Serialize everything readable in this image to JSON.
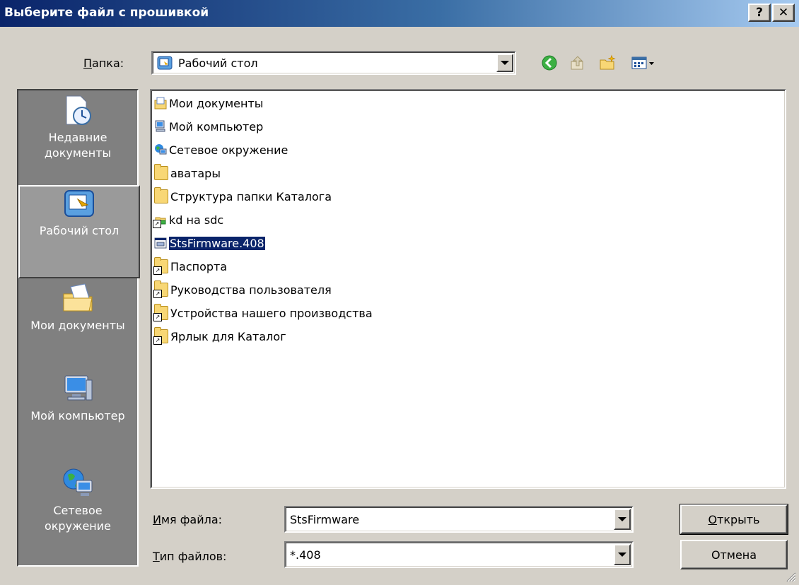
{
  "window": {
    "title": "Выберите файл с прошивкой",
    "help_button": "?",
    "close_button": "✕"
  },
  "look_in": {
    "label_prefix": "П",
    "label_rest": "апка:",
    "value": "Рабочий стол"
  },
  "places_bar": {
    "items": [
      {
        "label": "Недавние документы",
        "icon": "recent-documents-icon"
      },
      {
        "label": "Рабочий стол",
        "icon": "desktop-icon",
        "selected": true
      },
      {
        "label": "Мои документы",
        "icon": "my-documents-icon"
      },
      {
        "label": "Мой компьютер",
        "icon": "my-computer-icon"
      },
      {
        "label": "Сетевое окружение",
        "icon": "network-places-icon"
      }
    ]
  },
  "file_list": {
    "items": [
      {
        "name": "Мои документы",
        "icon": "my-documents-icon"
      },
      {
        "name": "Мой компьютер",
        "icon": "my-computer-icon"
      },
      {
        "name": "Сетевое окружение",
        "icon": "network-places-icon"
      },
      {
        "name": "аватары",
        "icon": "folder-icon"
      },
      {
        "name": "Структура папки Каталога",
        "icon": "folder-icon"
      },
      {
        "name": "kd на sdc",
        "icon": "network-drive-shortcut-icon"
      },
      {
        "name": "StsFirmware.408",
        "icon": "firmware-file-icon",
        "selected": true
      },
      {
        "name": "Паспорта",
        "icon": "folder-shortcut-icon"
      },
      {
        "name": "Руководства пользователя",
        "icon": "folder-shortcut-icon"
      },
      {
        "name": "Устройства нашего производства",
        "icon": "folder-shortcut-icon"
      },
      {
        "name": "Ярлык для Каталог",
        "icon": "folder-shortcut-icon"
      }
    ]
  },
  "filename": {
    "label_prefix": "И",
    "label_rest": "мя файла:",
    "value": "StsFirmware"
  },
  "filetype": {
    "label_prefix": "Т",
    "label_rest": "ип файлов:",
    "value": "*.408"
  },
  "buttons": {
    "open_prefix": "О",
    "open_rest": "ткрыть",
    "cancel": "Отмена"
  },
  "colors": {
    "titlebar_start": "#0a246a",
    "titlebar_end": "#a6caf0",
    "dialog_face": "#d4d0c8",
    "places_bar_bg": "#808080",
    "selection": "#0a246a"
  }
}
